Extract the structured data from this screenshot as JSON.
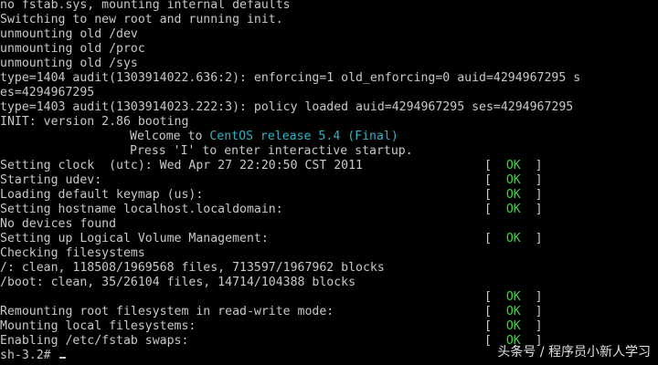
{
  "console": {
    "lines": [
      "no fstab.sys, mounting internal defaults",
      "Switching to new root and running init.",
      "unmounting old /dev",
      "unmounting old /proc",
      "unmounting old /sys",
      "type=1404 audit(1303914022.636:2): enforcing=1 old_enforcing=0 auid=4294967295 s",
      "es=4294967295",
      "type=1403 audit(1303914023.222:3): policy loaded auid=4294967295 ses=4294967295",
      "INIT: version 2.86 booting",
      "Setting clock  (utc): Wed Apr 27 22:20:50 CST 2011",
      "Starting udev:",
      "Loading default keymap (us):",
      "Setting hostname localhost.localdomain:",
      "No devices found",
      "Setting up Logical Volume Management:",
      "Checking filesystems",
      "/: clean, 118508/1969568 files, 713597/1967962 blocks",
      "/boot: clean, 35/26104 files, 14714/104388 blocks",
      "Remounting root filesystem in read-write mode:",
      "Mounting local filesystems:",
      "Enabling /etc/fstab swaps:"
    ],
    "welcome_prefix": "Welcome to ",
    "welcome_release": "CentOS release 5.4 (Final)",
    "press_hint": "Press 'I' to enter interactive startup.",
    "status_open": "[  ",
    "status_ok": "OK",
    "status_close": "  ]",
    "prompt": "sh-3.2# "
  },
  "colors": {
    "text": "#c8c8c8",
    "ok": "#39d33b",
    "release": "#2fb3c4",
    "background": "#000000"
  },
  "watermark": {
    "text": "头条号 / 程序员小新人学习"
  }
}
